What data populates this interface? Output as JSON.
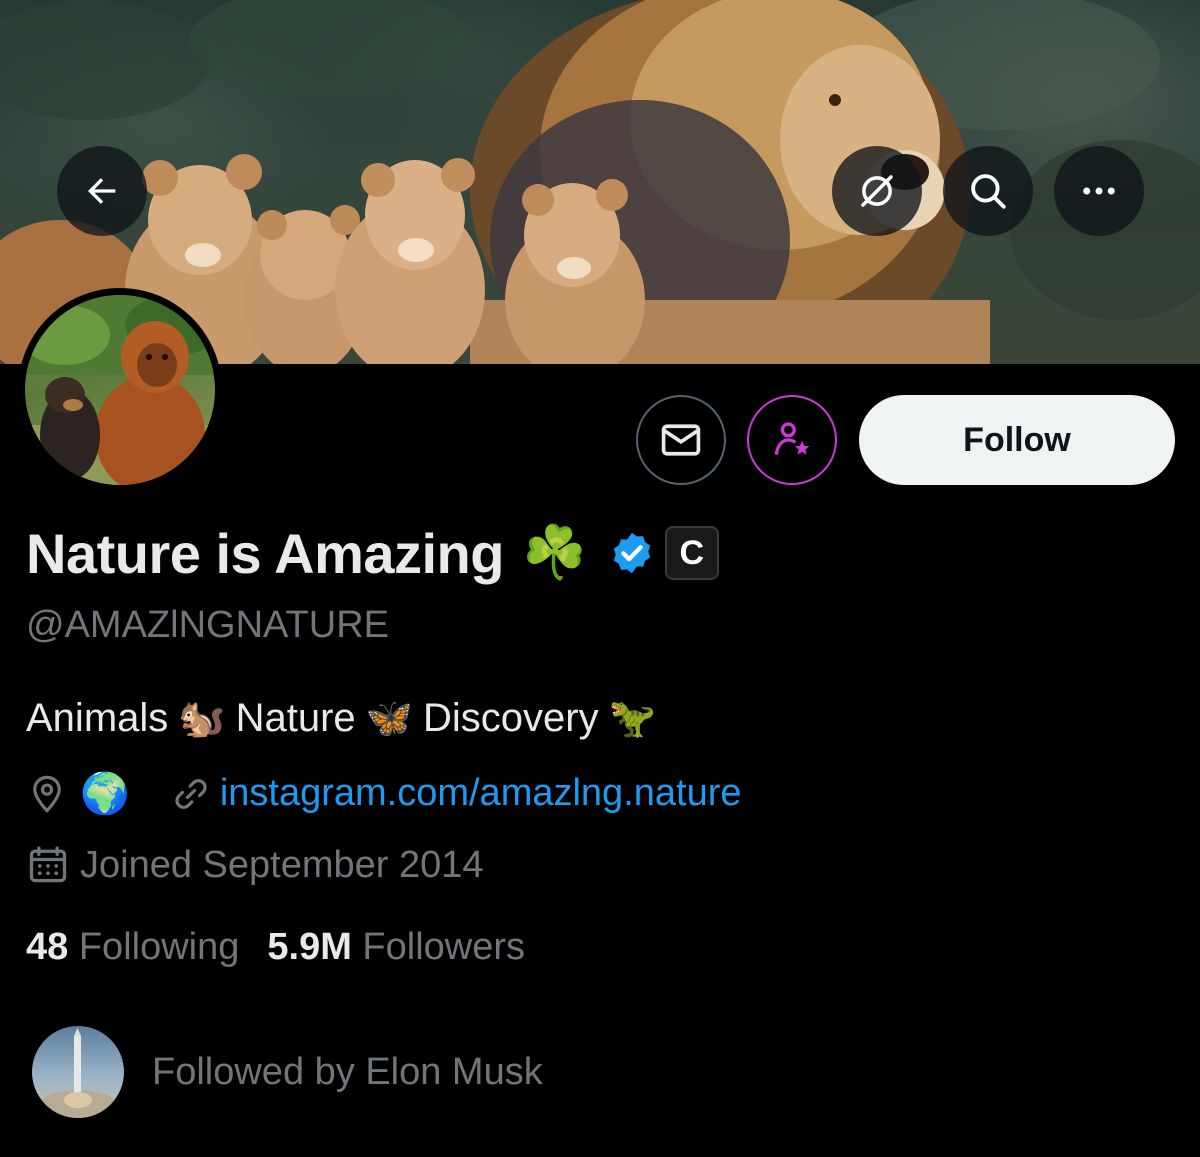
{
  "header": {
    "back_icon": "arrow-left-icon",
    "grok_icon": "grok-icon",
    "search_icon": "search-icon",
    "more_icon": "more-horizontal-icon"
  },
  "profile": {
    "display_name": "Nature is Amazing",
    "name_emoji": "☘️",
    "verified_color": "#1d9bf0",
    "affiliate_badge": "C",
    "handle": "@AMAZlNGNATURE",
    "bio": {
      "word1": "Animals",
      "emoji1": "🐿️",
      "word2": "Nature",
      "emoji2": "🦋",
      "word3": "Discovery",
      "emoji3": "🦖"
    },
    "location_emoji": "🌍",
    "website": "instagram.com/amazlng.nature",
    "joined": "Joined September 2014",
    "following_count": "48",
    "following_label": "Following",
    "followers_count": "5.9M",
    "followers_label": "Followers",
    "followed_by": "Followed by Elon Musk"
  },
  "actions": {
    "message_icon": "envelope-icon",
    "subscribe_icon": "person-star-icon",
    "subscribe_color": "#c93ad7",
    "follow_label": "Follow"
  },
  "colors": {
    "background": "#000000",
    "text_primary": "#e7e9ea",
    "text_secondary": "#71767b",
    "link": "#1d9bf0"
  }
}
